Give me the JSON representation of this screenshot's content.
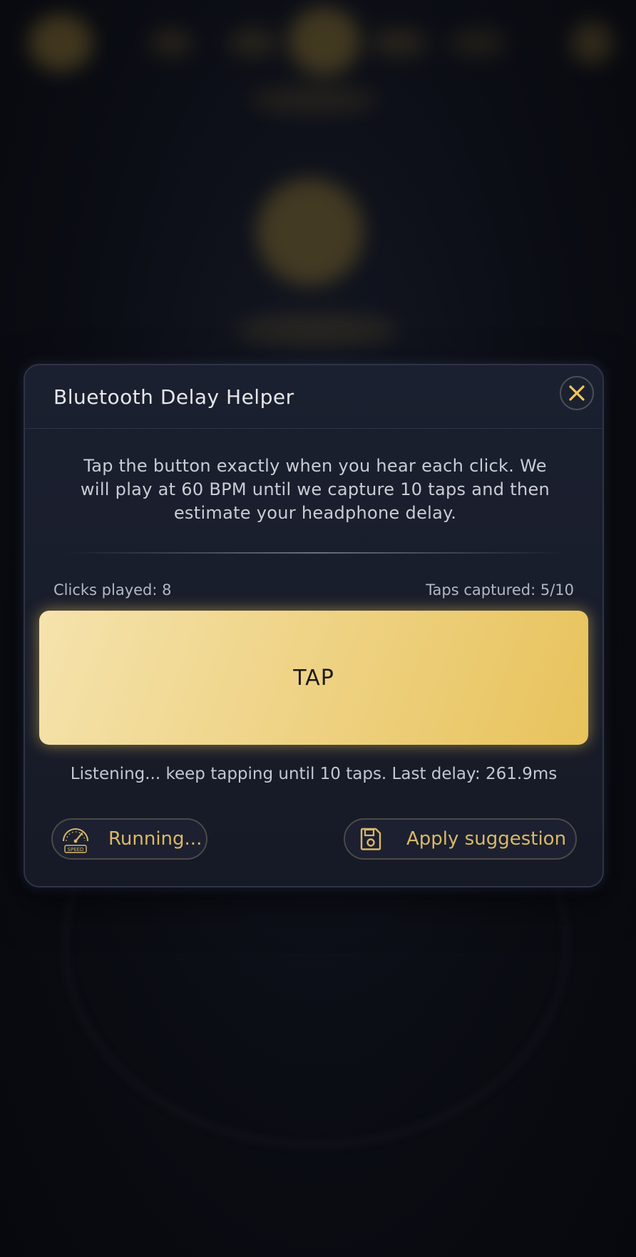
{
  "colors": {
    "accent_gold": "#d9b869",
    "tap_button_start": "#f5e3ad",
    "tap_button_end": "#e8c35c",
    "modal_bg": "#1b2030",
    "text_primary": "#e6e6ea"
  },
  "modal": {
    "title": "Bluetooth Delay Helper",
    "close_icon": "close-icon",
    "intro_text": "Tap the button exactly when you hear each click. We will play at 60 BPM until we capture 10 taps and then estimate your headphone delay.",
    "clicks_played_label": "Clicks played: 8",
    "taps_captured_label": "Taps captured: 5/10",
    "tap_button_label": "TAP",
    "status_text": "Listening... keep tapping until 10 taps. Last delay: 261.9ms",
    "running_button": {
      "label": "Running...",
      "icon": "speedometer-icon",
      "icon_caption": "SPEED"
    },
    "apply_button": {
      "label": "Apply suggestion",
      "icon": "save-icon"
    }
  }
}
